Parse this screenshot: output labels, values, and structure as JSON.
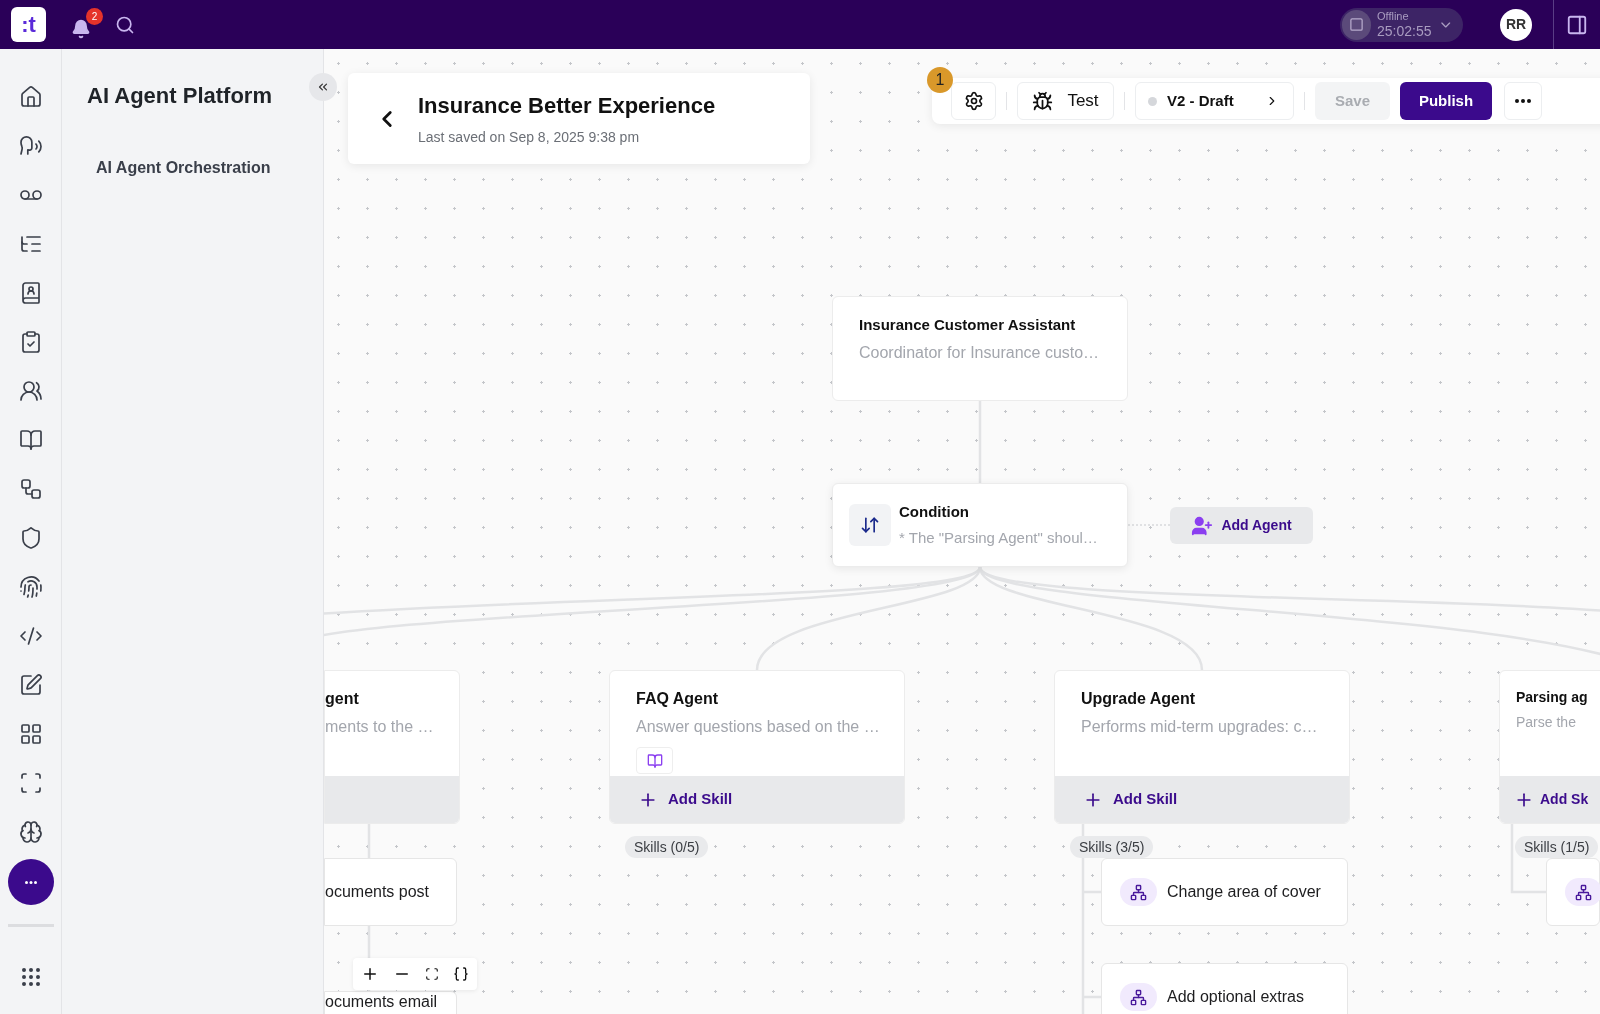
{
  "top_bar": {
    "logo": ":t",
    "notification_count": "2",
    "status": {
      "label": "Offline",
      "timer": "25:02:55"
    },
    "avatar": "RR"
  },
  "sidebar": {
    "title": "AI Agent Platform",
    "items": [
      {
        "label": "AI Agent Orchestration"
      }
    ]
  },
  "header": {
    "title": "Insurance Better Experience",
    "subtitle": "Last saved on Sep 8, 2025 9:38 pm"
  },
  "toolbar": {
    "badge": "1",
    "test": "Test",
    "version": "V2 - Draft",
    "save": {
      "label": "Save",
      "disabled": true
    },
    "publish": "Publish"
  },
  "canvas": {
    "nodes": [
      {
        "kind": "agent",
        "title": "Insurance Customer Assistant",
        "description": "Coordinator for Insurance custo…"
      },
      {
        "kind": "condition",
        "title": "Condition",
        "description": "* The \"Parsing Agent\" shoul…"
      }
    ],
    "add_agent": "Add Agent",
    "agents": [
      {
        "title": "gent",
        "description": "ments to the …",
        "knowledge": false,
        "skills": [
          {
            "kind": "text",
            "label": "ocuments post"
          },
          {
            "kind": "text",
            "label": "ocuments email"
          }
        ]
      },
      {
        "title": "FAQ Agent",
        "description": "Answer questions based on the …",
        "knowledge": true,
        "add_skill": "Add Skill",
        "skills_count": "Skills (0/5)"
      },
      {
        "title": "Upgrade Agent",
        "description": "Performs mid-term upgrades: c…",
        "knowledge": false,
        "add_skill": "Add Skill",
        "skills_count": "Skills (3/5)",
        "skills": [
          {
            "kind": "skill",
            "label": "Change area of cover"
          },
          {
            "kind": "skill",
            "label": "Add optional extras"
          }
        ]
      },
      {
        "title": "Parsing ag",
        "description": "Parse the",
        "knowledge": false,
        "add_skill": "Add Sk",
        "skills_count": "Skills (1/5)",
        "skills": [
          {
            "kind": "icon"
          }
        ]
      }
    ]
  }
}
